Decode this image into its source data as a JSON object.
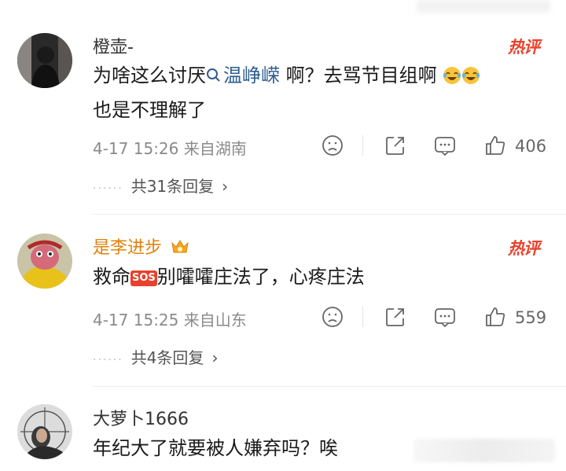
{
  "comments": [
    {
      "username": "橙壶-",
      "hot_tag": "热评",
      "text_line1_before": "为啥这么讨厌",
      "search_term": "温峥嵘",
      "text_line1_after": " 啊？去骂节目组啊",
      "text_line2": "也是不理解了",
      "meta": "4-17 15:26 来自湖南",
      "like_count": "406",
      "replies_label": "共31条回复"
    },
    {
      "username": "是李进步",
      "hot_tag": "热评",
      "text_before": "救命",
      "sos": "SOS",
      "text_after": "别嚯嚯庄法了，心疼庄法",
      "meta": "4-17 15:25 来自山东",
      "like_count": "559",
      "replies_label": "共4条回复"
    },
    {
      "username": "大萝卜1666",
      "text": "年纪大了就要被人嫌弃吗？唉"
    }
  ],
  "colors": {
    "hot": "#e8412c",
    "link": "#2f5d91",
    "vip_name": "#e0820e",
    "meta": "#8a8a8a"
  },
  "icons": [
    "search-icon",
    "dislike-icon",
    "share-icon",
    "comment-icon",
    "like-icon",
    "chevron-right-icon",
    "crown-badge-icon"
  ]
}
